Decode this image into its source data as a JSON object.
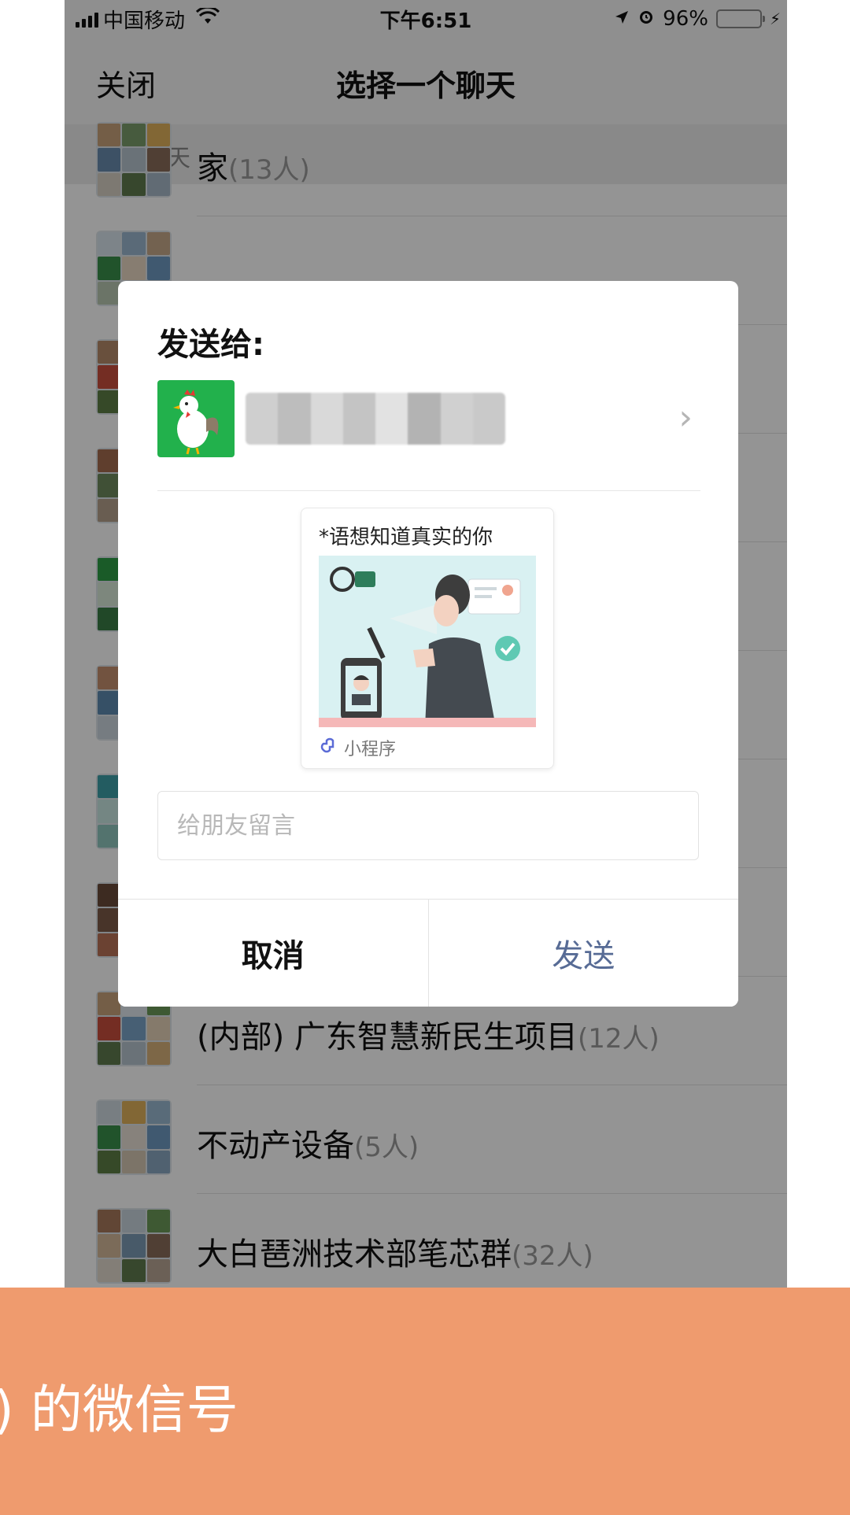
{
  "status_bar": {
    "carrier": "中国移动",
    "time": "下午6:51",
    "battery": "96%",
    "battery_level": 0.96
  },
  "nav": {
    "close": "关闭",
    "title": "选择一个聊天"
  },
  "section_header": "最近聊天",
  "chats": [
    {
      "name": "家",
      "count": "(13人)"
    },
    {
      "name": "",
      "count": ""
    },
    {
      "name": "",
      "count": ""
    },
    {
      "name": "",
      "count": ""
    },
    {
      "name": "",
      "count": ""
    },
    {
      "name": "",
      "count": ""
    },
    {
      "name": "",
      "count": ""
    },
    {
      "name": "",
      "count": ""
    },
    {
      "name": "(内部) 广东智慧新民生项目",
      "count": "(12人)"
    },
    {
      "name": "不动产设备",
      "count": "(5人)"
    },
    {
      "name": "大白琶洲技术部笔芯群",
      "count": "(32人)"
    }
  ],
  "dialog": {
    "title": "发送给:",
    "card_title": "*语想知道真实的你",
    "card_footer": "小程序",
    "message_placeholder": "给朋友留言",
    "cancel": "取消",
    "send": "发送"
  },
  "banner": {
    "text": ") 的微信号"
  },
  "colors": {
    "send_button": "#576b95",
    "banner_bg": "#ef9b6e",
    "recipient_avatar": "#22b14c"
  }
}
